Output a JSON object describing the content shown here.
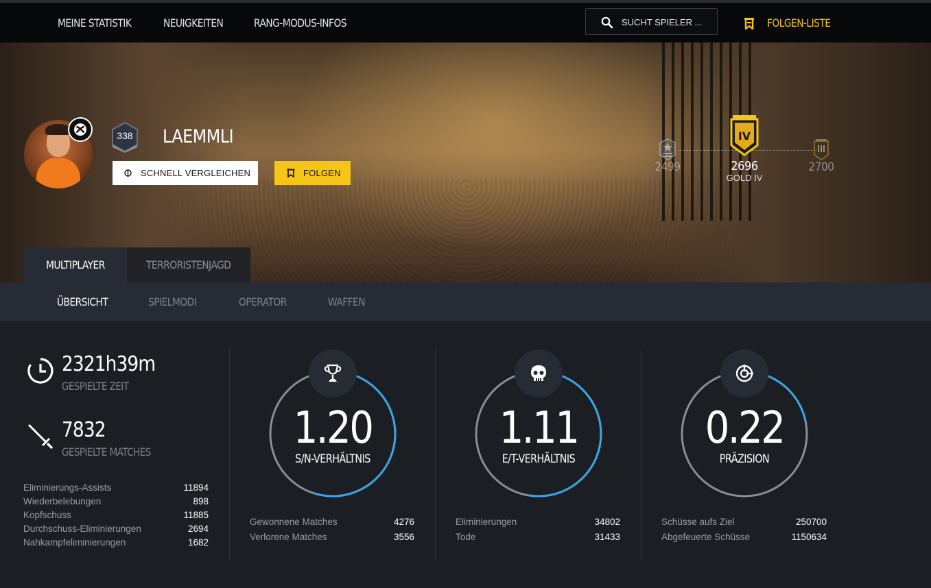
{
  "nav": {
    "items": [
      {
        "label": "MEINE STATISTIK"
      },
      {
        "label": "NEUIGKEITEN"
      },
      {
        "label": "RANG-MODUS-INFOS"
      }
    ],
    "search_placeholder": "SUCHT SPIELER ...",
    "follow_list_label": "FOLGEN-LISTE",
    "search_icon": "search-icon",
    "follow_list_icon": "bookmark-icon"
  },
  "profile": {
    "name": "LAEMMLI",
    "level": "338",
    "platform_icon": "xbox-icon",
    "compare_label": "SCHNELL VERGLEICHEN",
    "follow_label": "FOLGEN"
  },
  "rank": {
    "prev_value": "2499",
    "current_value": "2696",
    "current_name": "GOLD IV",
    "current_emblem": "IV",
    "next_value": "2700"
  },
  "mode_tabs": [
    {
      "label": "MULTIPLAYER",
      "active": true
    },
    {
      "label": "TERRORISTENJAGD",
      "active": false
    }
  ],
  "sub_tabs": [
    {
      "label": "ÜBERSICHT",
      "active": true
    },
    {
      "label": "SPIELMODI",
      "active": false
    },
    {
      "label": "OPERATOR",
      "active": false
    },
    {
      "label": "WAFFEN",
      "active": false
    }
  ],
  "summary": {
    "time_played": {
      "value": "2321h39m",
      "label": "GESPIELTE ZEIT",
      "icon": "clock-icon"
    },
    "matches_played": {
      "value": "7832",
      "label": "GESPIELTE MATCHES",
      "icon": "sword-icon"
    },
    "details": [
      {
        "label": "Eliminierungs-Assists",
        "value": "11894"
      },
      {
        "label": "Wiederbelebungen",
        "value": "898"
      },
      {
        "label": "Kopfschuss",
        "value": "11885"
      },
      {
        "label": "Durchschuss-Eliminierungen",
        "value": "2694"
      },
      {
        "label": "Nahkampfeliminierungen",
        "value": "1682"
      }
    ]
  },
  "gauges": [
    {
      "value": "1.20",
      "label": "S/N-VERHÄLTNIS",
      "icon": "trophy-icon",
      "fraction": 0.5454,
      "rows": [
        {
          "label": "Gewonnene Matches",
          "value": "4276"
        },
        {
          "label": "Verlorene Matches",
          "value": "3556"
        }
      ]
    },
    {
      "value": "1.11",
      "label": "E/T-VERHÄLTNIS",
      "icon": "skull-icon",
      "fraction": 0.5256,
      "rows": [
        {
          "label": "Eliminierungen",
          "value": "34802"
        },
        {
          "label": "Tode",
          "value": "31433"
        }
      ]
    },
    {
      "value": "0.22",
      "label": "PRÄZISION",
      "icon": "crosshair-icon",
      "fraction": 0.22,
      "rows": [
        {
          "label": "Schüsse aufs Ziel",
          "value": "250700"
        },
        {
          "label": "Abgefeuerte Schüsse",
          "value": "1150634"
        }
      ]
    }
  ],
  "colors": {
    "accent_yellow": "#f5c518",
    "gauge_blue": "#3aa3e3",
    "gauge_track": "#8a8e96",
    "panel": "#272b33",
    "background": "#1b1e23"
  }
}
